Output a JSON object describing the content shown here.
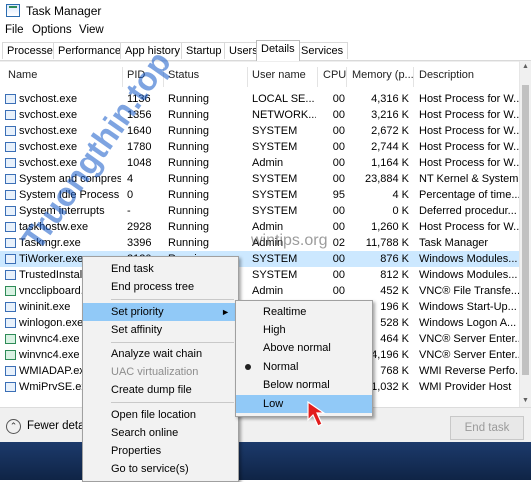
{
  "window": {
    "title": "Task Manager"
  },
  "menu": [
    "File",
    "Options",
    "View"
  ],
  "tabs": [
    "Processes",
    "Performance",
    "App history",
    "Startup",
    "Users",
    "Details",
    "Services"
  ],
  "active_tab": "Details",
  "columns": [
    "Name",
    "PID",
    "Status",
    "User name",
    "CPU",
    "Memory (p...",
    "Description"
  ],
  "rows": [
    {
      "name": "svchost.exe",
      "pid": "1136",
      "status": "Running",
      "user": "LOCAL SE...",
      "cpu": "00",
      "mem": "4,316 K",
      "desc": "Host Process for W..."
    },
    {
      "name": "svchost.exe",
      "pid": "1356",
      "status": "Running",
      "user": "NETWORK...",
      "cpu": "00",
      "mem": "3,216 K",
      "desc": "Host Process for W..."
    },
    {
      "name": "svchost.exe",
      "pid": "1640",
      "status": "Running",
      "user": "SYSTEM",
      "cpu": "00",
      "mem": "2,672 K",
      "desc": "Host Process for W..."
    },
    {
      "name": "svchost.exe",
      "pid": "1780",
      "status": "Running",
      "user": "SYSTEM",
      "cpu": "00",
      "mem": "2,744 K",
      "desc": "Host Process for W..."
    },
    {
      "name": "svchost.exe",
      "pid": "1048",
      "status": "Running",
      "user": "Admin",
      "cpu": "00",
      "mem": "1,164 K",
      "desc": "Host Process for W..."
    },
    {
      "name": "System and compres...",
      "pid": "4",
      "status": "Running",
      "user": "SYSTEM",
      "cpu": "00",
      "mem": "23,884 K",
      "desc": "NT Kernel & System"
    },
    {
      "name": "System Idle Process",
      "pid": "0",
      "status": "Running",
      "user": "SYSTEM",
      "cpu": "95",
      "mem": "4 K",
      "desc": "Percentage of time..."
    },
    {
      "name": "System interrupts",
      "pid": "-",
      "status": "Running",
      "user": "SYSTEM",
      "cpu": "00",
      "mem": "0 K",
      "desc": "Deferred procedur..."
    },
    {
      "name": "taskhostw.exe",
      "pid": "2928",
      "status": "Running",
      "user": "Admin",
      "cpu": "00",
      "mem": "1,260 K",
      "desc": "Host Process for W..."
    },
    {
      "name": "Taskmgr.exe",
      "pid": "3396",
      "status": "Running",
      "user": "Admin",
      "cpu": "02",
      "mem": "11,788 K",
      "desc": "Task Manager"
    },
    {
      "name": "TiWorker.exe",
      "pid": "2120",
      "status": "Running",
      "user": "SYSTEM",
      "cpu": "00",
      "mem": "876 K",
      "desc": "Windows Modules..."
    },
    {
      "name": "TrustedInstaller.exe",
      "pid": "",
      "status": "",
      "user": "SYSTEM",
      "cpu": "00",
      "mem": "812 K",
      "desc": "Windows Modules..."
    },
    {
      "name": "vncclipboard.exe",
      "pid": "",
      "status": "",
      "user": "Admin",
      "cpu": "00",
      "mem": "452 K",
      "desc": "VNC® File Transfe..."
    },
    {
      "name": "wininit.exe",
      "pid": "",
      "status": "",
      "user": "",
      "cpu": "",
      "mem": "196 K",
      "desc": "Windows Start-Up..."
    },
    {
      "name": "winlogon.exe",
      "pid": "",
      "status": "",
      "user": "",
      "cpu": "",
      "mem": "528 K",
      "desc": "Windows Logon A..."
    },
    {
      "name": "winvnc4.exe",
      "pid": "",
      "status": "",
      "user": "",
      "cpu": "",
      "mem": "464 K",
      "desc": "VNC® Server Enter..."
    },
    {
      "name": "winvnc4.exe",
      "pid": "",
      "status": "",
      "user": "",
      "cpu": "",
      "mem": "44,196 K",
      "desc": "VNC® Server Enter..."
    },
    {
      "name": "WMIADAP.exe",
      "pid": "",
      "status": "",
      "user": "",
      "cpu": "",
      "mem": "768 K",
      "desc": "WMI Reverse Perfo..."
    },
    {
      "name": "WmiPrvSE.exe",
      "pid": "",
      "status": "",
      "user": "",
      "cpu": "",
      "mem": "1,032 K",
      "desc": "WMI Provider Host"
    }
  ],
  "context_menu": {
    "items": [
      "End task",
      "End process tree",
      "Set priority",
      "Set affinity",
      "Analyze wait chain",
      "UAC virtualization",
      "Create dump file",
      "Open file location",
      "Search online",
      "Properties",
      "Go to service(s)"
    ],
    "submenu_arrow": "►"
  },
  "priority_menu": [
    "Realtime",
    "High",
    "Above normal",
    "Normal",
    "Below normal",
    "Low"
  ],
  "footer": {
    "fewer_details": "Fewer details",
    "end_task": "End task"
  },
  "watermarks": [
    "Truongthin.top",
    "wintips.org"
  ],
  "colors": {
    "selected_row": "#cce8ff",
    "menu_highlight": "#91c9f7",
    "arrow": "#e21d1d"
  }
}
